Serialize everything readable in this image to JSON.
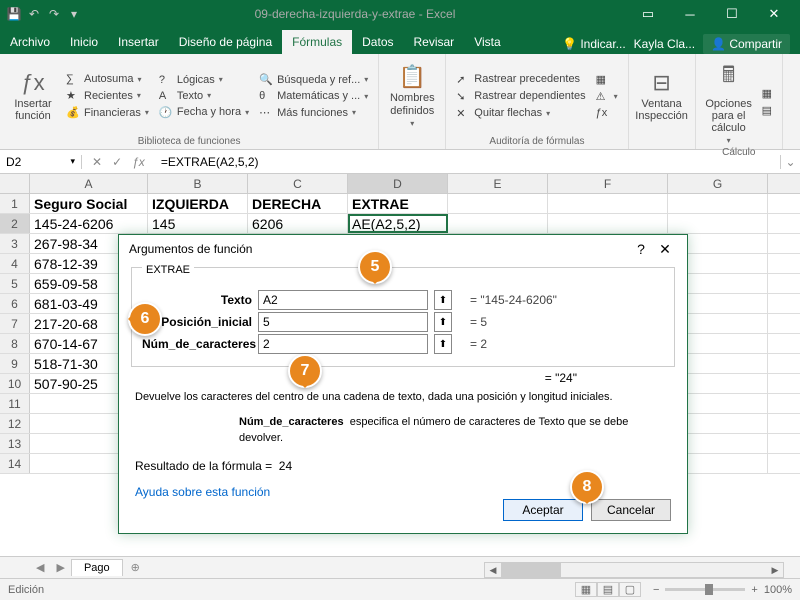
{
  "titlebar": {
    "doc": "09-derecha-izquierda-y-extrae - Excel"
  },
  "menu": {
    "tabs": [
      "Archivo",
      "Inicio",
      "Insertar",
      "Diseño de página",
      "Fórmulas",
      "Datos",
      "Revisar",
      "Vista"
    ],
    "active": 4,
    "tell": "Indicar...",
    "user": "Kayla Cla...",
    "share": "Compartir"
  },
  "ribbon": {
    "insert_fn": "Insertar función",
    "lib": {
      "autosum": "Autosuma",
      "logic": "Lógicas",
      "search": "Búsqueda y ref...",
      "recent": "Recientes",
      "text": "Texto",
      "math": "Matemáticas y ...",
      "fin": "Financieras",
      "date": "Fecha y hora",
      "more": "Más funciones",
      "label": "Biblioteca de funciones"
    },
    "names": {
      "btn": "Nombres definidos"
    },
    "audit": {
      "prec": "Rastrear precedentes",
      "dep": "Rastrear dependientes",
      "rem": "Quitar flechas",
      "label": "Auditoría de fórmulas"
    },
    "watch": {
      "btn": "Ventana Inspección"
    },
    "calc": {
      "btn": "Opciones para el cálculo",
      "label": "Cálculo"
    }
  },
  "namebox": "D2",
  "formula": "=EXTRAE(A2,5,2)",
  "headers": [
    "A",
    "B",
    "C",
    "D",
    "E",
    "F",
    "G"
  ],
  "rows": [
    {
      "n": "1",
      "a": "Seguro Social",
      "b": "IZQUIERDA",
      "c": "DERECHA",
      "d": "EXTRAE",
      "bold": true
    },
    {
      "n": "2",
      "a": "145-24-6206",
      "b": "145",
      "c": "6206",
      "d": "AE(A2,5,2)",
      "active": true
    },
    {
      "n": "3",
      "a": "267-98-34"
    },
    {
      "n": "4",
      "a": "678-12-39"
    },
    {
      "n": "5",
      "a": "659-09-58"
    },
    {
      "n": "6",
      "a": "681-03-49"
    },
    {
      "n": "7",
      "a": "217-20-68"
    },
    {
      "n": "8",
      "a": "670-14-67"
    },
    {
      "n": "9",
      "a": "518-71-30"
    },
    {
      "n": "10",
      "a": "507-90-25"
    },
    {
      "n": "11",
      "a": ""
    },
    {
      "n": "12",
      "a": ""
    },
    {
      "n": "13",
      "a": ""
    },
    {
      "n": "14",
      "a": ""
    }
  ],
  "dialog": {
    "title": "Argumentos de función",
    "fn": "EXTRAE",
    "fields": {
      "texto": {
        "label": "Texto",
        "value": "A2",
        "result": "\"145-24-6206\""
      },
      "pos": {
        "label": "Posición_inicial",
        "value": "5",
        "result": "5"
      },
      "num": {
        "label": "Núm_de_caracteres",
        "value": "2",
        "result": "2"
      }
    },
    "preview": "= \"24\"",
    "desc1": "Devuelve los caracteres del centro de una cadena de texto, dada una posición y longitud iniciales.",
    "arg": "Núm_de_caracteres",
    "desc2": "especifica el número de caracteres de Texto que se debe devolver.",
    "result_label": "Resultado de la fórmula =",
    "result_value": "24",
    "help": "Ayuda sobre esta función",
    "ok": "Aceptar",
    "cancel": "Cancelar"
  },
  "callouts": {
    "c5": "5",
    "c6": "6",
    "c7": "7",
    "c8": "8"
  },
  "sheet": "Pago",
  "status": {
    "edit": "Edición",
    "zoom": "100%"
  }
}
